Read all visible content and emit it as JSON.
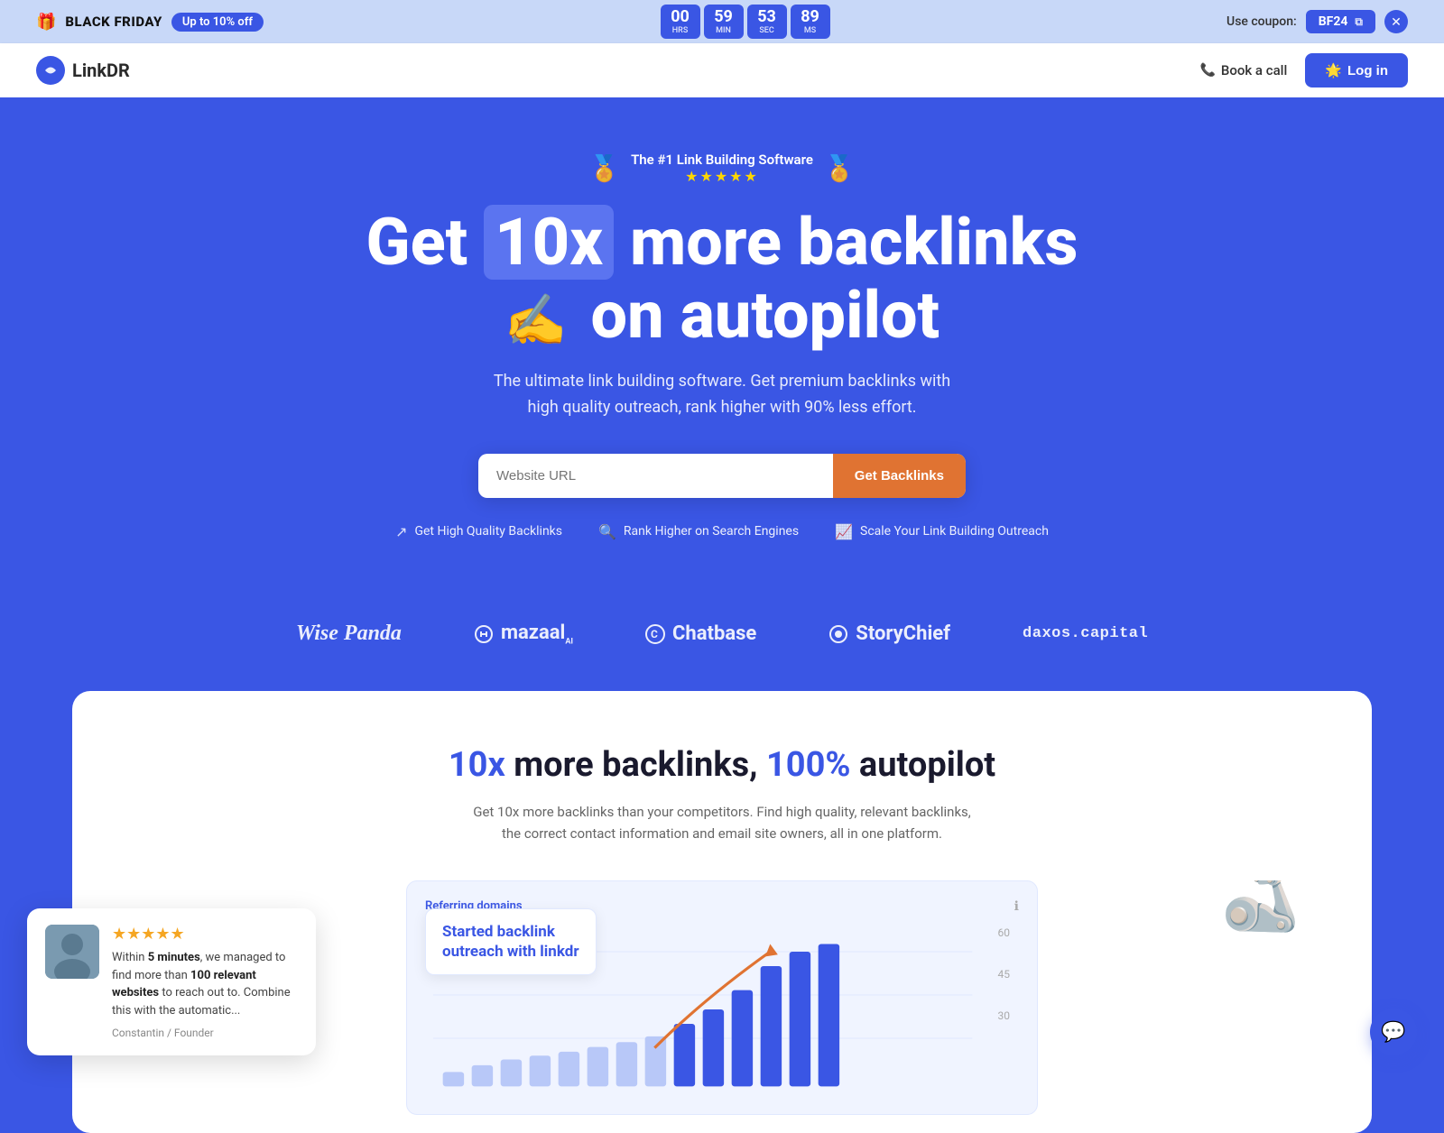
{
  "banner": {
    "gift_icon": "🎁",
    "black_friday_label": "BLACK FRIDAY",
    "discount_badge": "Up to 10% off",
    "timer": {
      "hrs": "00",
      "min": "59",
      "sec": "53",
      "ms": "89",
      "hrs_label": "HRS",
      "min_label": "MIN",
      "sec_label": "SEC",
      "ms_label": "MS"
    },
    "coupon_prefix": "Use coupon:",
    "coupon_code": "BF24",
    "close_icon": "✕"
  },
  "navbar": {
    "logo_text": "LinkDR",
    "logo_icon": "↗",
    "book_call_label": "Book a call",
    "phone_icon": "📞",
    "login_label": "Log in",
    "login_emoji": "🌟"
  },
  "hero": {
    "badge_text": "The #1 Link Building Software",
    "stars": "★★★★★",
    "title_part1": "Get ",
    "title_highlight": "10x",
    "title_part2": " more backlinks",
    "title_line2_emoji": "✍️",
    "title_line2": " on autopilot",
    "subtitle": "The ultimate link building software. Get premium backlinks with high quality outreach, rank higher with 90% less effort.",
    "input_placeholder": "Website URL",
    "cta_button": "Get Backlinks",
    "feature1": "Get High Quality Backlinks",
    "feature2": "Rank Higher on Search Engines",
    "feature3": "Scale Your Link Building Outreach",
    "feature1_icon": "↗",
    "feature2_icon": "🔍",
    "feature3_icon": "📈"
  },
  "logos": [
    {
      "name": "Wise Panda",
      "style": "bold"
    },
    {
      "name": "mazaal",
      "style": "normal",
      "prefix_icon": "ᵯ"
    },
    {
      "name": "Chatbase",
      "style": "normal",
      "prefix_icon": "©"
    },
    {
      "name": "StoryChief",
      "style": "normal",
      "prefix_icon": "◉"
    },
    {
      "name": "daxos.capital",
      "style": "mono"
    }
  ],
  "card": {
    "title_blue": "10x",
    "title_mid": " more backlinks, ",
    "title_blue2": "100%",
    "title_end": " autopilot",
    "subtitle": "Get 10x more backlinks than your competitors. Find high quality, relevant backlinks, the correct contact information and email site owners, all in one platform.",
    "chart_label": "Referring domains",
    "chart_annotation_title": "Started backlink\noutreach with linkdr",
    "chart_y_labels": [
      "60",
      "45",
      "30"
    ],
    "chart_x_labels": []
  },
  "review": {
    "stars": "★★★★★",
    "text_prefix": "Within ",
    "bold1": "5 minutes",
    "text_mid": ", we managed to find more than ",
    "bold2": "100 relevant websites",
    "text_suffix": " to reach out to. Combine this with the automatic...",
    "author": "Constantin / Founder"
  },
  "chat": {
    "icon": "💬"
  }
}
